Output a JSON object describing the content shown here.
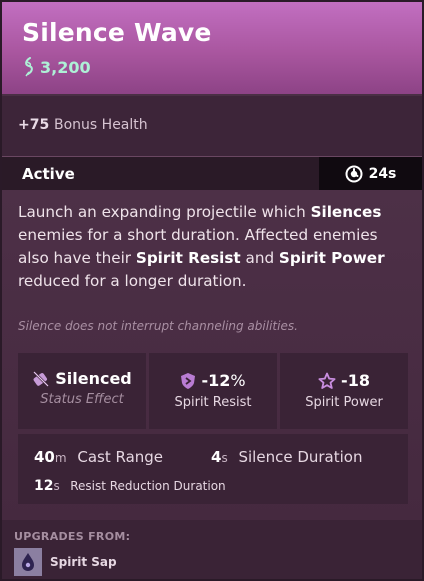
{
  "item": {
    "name": "Silence Wave",
    "cost": "3,200",
    "colors": {
      "header": "#b062ad",
      "cost": "#aef0d6",
      "body": "#4a2f45"
    }
  },
  "bonus": {
    "value": "+75",
    "label": "Bonus Health"
  },
  "active": {
    "label": "Active",
    "cooldown": "24s",
    "cooldown_icon": "cooldown-icon"
  },
  "description": {
    "p1": "Launch an expanding projectile which ",
    "k1": "Silences",
    "p2": " enemies for a short duration. Affected enemies also have their ",
    "k2": "Spirit Resist",
    "p3": " and ",
    "k3": "Spirit Power",
    "p4": " reduced for a longer duration."
  },
  "note": "Silence does not interrupt channeling abilities.",
  "stats": {
    "silenced": {
      "label": "Silenced",
      "sub": "Status Effect",
      "icon": "silence-icon"
    },
    "spirit_resist": {
      "value": "-12",
      "unit": "%",
      "label": "Spirit Resist",
      "icon": "shield-icon"
    },
    "spirit_power": {
      "value": "-18",
      "label": "Spirit Power",
      "icon": "star-icon"
    }
  },
  "properties": {
    "cast_range": {
      "value": "40",
      "unit": "m",
      "label": "Cast Range"
    },
    "silence_duration": {
      "value": "4",
      "unit": "s",
      "label": "Silence Duration"
    },
    "resist_reduction": {
      "value": "12",
      "unit": "s",
      "label": "Resist Reduction Duration"
    }
  },
  "upgrades": {
    "title": "UPGRADES FROM:",
    "items": [
      {
        "label": "Spirit Sap",
        "icon": "spirit-sap-icon"
      }
    ]
  }
}
